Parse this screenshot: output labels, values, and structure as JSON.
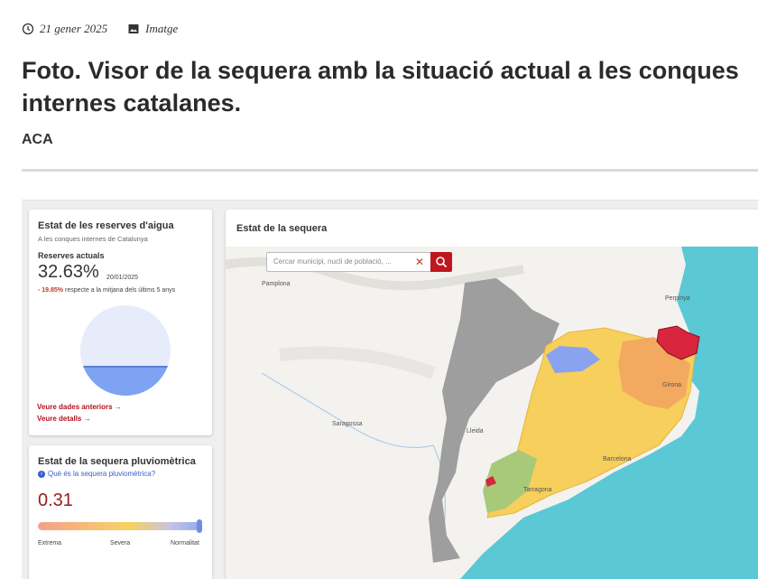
{
  "meta": {
    "date": "21 gener 2025",
    "type": "Imatge"
  },
  "article": {
    "title": "Foto. Visor de la sequera amb la situació actual a les conques internes catalanes.",
    "author": "ACA"
  },
  "reserves": {
    "title": "Estat de les reserves d'aigua",
    "subtitle": "A les conques internes de Catalunya",
    "label": "Reserves actuals",
    "value": "32.63%",
    "date": "20/01/2025",
    "delta": "- 19.85%",
    "delta_text": "respecte a la mitjana dels últims 5 anys",
    "fill_fraction": 0.3263,
    "link_previous": "Veure dades anteriors",
    "link_details": "Veure detalls"
  },
  "pluvio": {
    "title": "Estat de la sequera pluviomètrica",
    "info_link": "Què és la sequera pluviomètrica?",
    "value": "0.31",
    "scale_labels": [
      "Extrema",
      "Severa",
      "Normalitat"
    ]
  },
  "map": {
    "title": "Estat de la sequera",
    "search_placeholder": "Cercar municipi, nucli de població, ...",
    "places": [
      "Pamplona",
      "Perpinya",
      "Saragossa",
      "Lleida",
      "Girona",
      "Barcelona",
      "Tarragona"
    ]
  },
  "colors": {
    "alert_red": "#d7263d",
    "emergency_orange": "#f4a460",
    "exceptional_yellow": "#f6cf5c",
    "normal_green": "#a8c97a",
    "prealert_blue": "#8aa3f0",
    "sea": "#5bc8d6",
    "grey_outside": "#9e9e9e"
  }
}
